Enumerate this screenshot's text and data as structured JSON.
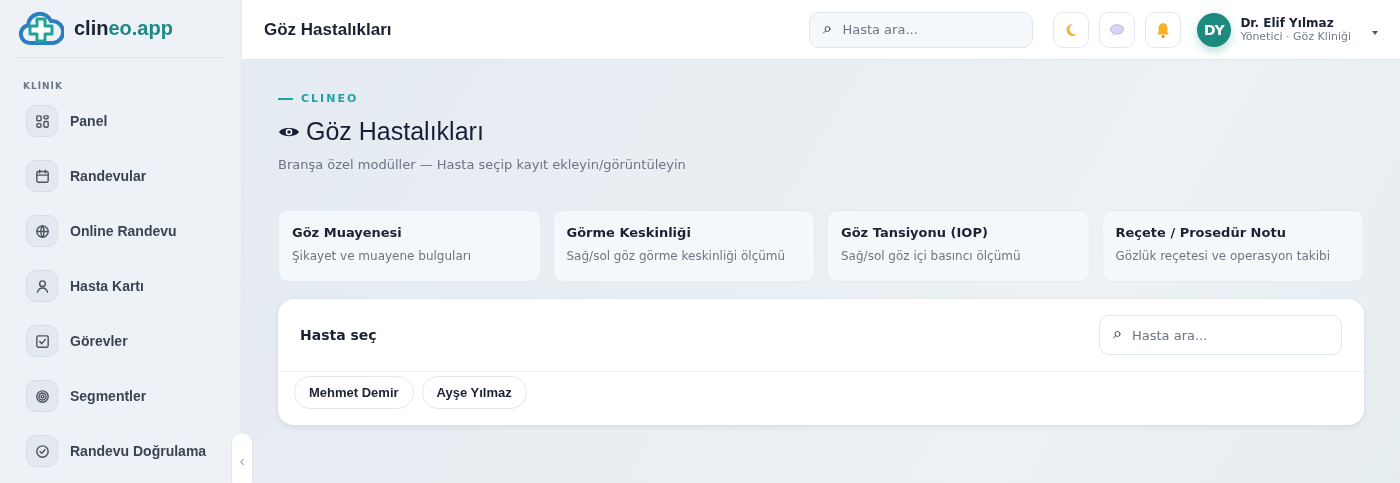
{
  "sidebar": {
    "logo": {
      "first": "clin",
      "accent": "eo.app"
    },
    "section": "KLİNİK",
    "items": [
      {
        "label": "Panel",
        "kind": "grid"
      },
      {
        "label": "Randevular",
        "kind": "calendar"
      },
      {
        "label": "Online Randevu",
        "kind": "globe"
      },
      {
        "label": "Hasta Kartı",
        "kind": "user"
      },
      {
        "label": "Görevler",
        "kind": "task"
      },
      {
        "label": "Segmentler",
        "kind": "target"
      },
      {
        "label": "Randevu Doğrulama",
        "kind": "verify"
      }
    ]
  },
  "topbar": {
    "title": "Göz Hastalıkları",
    "search": {
      "placeholder": "Hasta ara..."
    },
    "user": {
      "initials": "DY",
      "name": "Dr. Elif Yılmaz",
      "role": "Yönetici · Göz Kliniği"
    }
  },
  "header": {
    "eyebrow": "CLINEO",
    "title": "Göz Hastalıkları",
    "subtitle": "Branşa özel modüller — Hasta seçip kayıt ekleyin/görüntüleyin"
  },
  "modules": [
    {
      "title": "Göz Muayenesi",
      "description": "Şikayet ve muayene bulguları"
    },
    {
      "title": "Görme Keskinliği",
      "description": "Sağ/sol göz görme keskinliği ölçümü"
    },
    {
      "title": "Göz Tansiyonu (IOP)",
      "description": "Sağ/sol göz içi basıncı ölçümü"
    },
    {
      "title": "Reçete / Prosedür Notu",
      "description": "Gözlük reçetesi ve operasyon takibi"
    }
  ],
  "patient_picker": {
    "title": "Hasta seç",
    "search": {
      "placeholder": "Hasta ara..."
    },
    "patients": [
      {
        "name": "Mehmet Demir"
      },
      {
        "name": "Ayşe Yılmaz"
      }
    ]
  }
}
